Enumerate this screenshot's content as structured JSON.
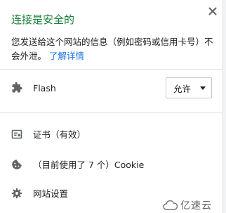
{
  "popup": {
    "title": "连接是安全的",
    "description": "您发送给这个网站的信息（例如密码或信用卡号）不会外泄。",
    "learn_more": "了解详情",
    "close_icon": "close-icon",
    "accent_green": "#188038",
    "link_color": "#1a73e8"
  },
  "permissions": {
    "flash": {
      "label": "Flash",
      "icon": "puzzle-icon",
      "select_value": "允许"
    }
  },
  "info": {
    "certificate": {
      "label": "证书（有效）",
      "icon": "certificate-icon"
    },
    "cookies": {
      "label": "（目前使用了 7 个）Cookie",
      "icon": "cookie-icon"
    },
    "site_settings": {
      "label": "网站设置",
      "icon": "gear-icon"
    }
  },
  "watermark": {
    "text": "亿速云"
  }
}
